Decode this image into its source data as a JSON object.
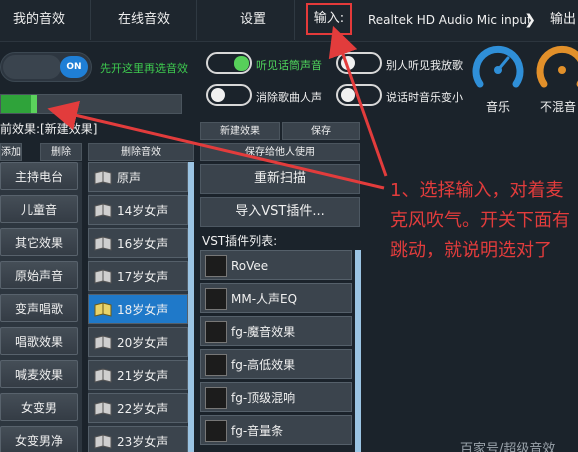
{
  "tabs": [
    "我的音效",
    "在线音效",
    "设置"
  ],
  "input_label": "输入:",
  "input_device": "Realtek HD Audio Mic input",
  "output_label": "输出",
  "main_toggle": {
    "state": "ON",
    "hint": "先开这里再选音效"
  },
  "toggles": [
    {
      "label": "听见话筒声音",
      "on": true
    },
    {
      "label": "别人听见我放歌",
      "on": false
    },
    {
      "label": "消除歌曲人声",
      "on": false
    },
    {
      "label": "说话时音乐变小",
      "on": false
    }
  ],
  "gauges": [
    {
      "label": "音乐",
      "color": "#2f8fd8"
    },
    {
      "label": "不混音",
      "color": "#e2902a"
    }
  ],
  "meter_level": 0.2,
  "current_effect": "前效果:[新建效果]",
  "buttons": {
    "add": "添加",
    "delete": "删除",
    "delete_effect": "删除音效",
    "new_effect": "新建效果",
    "save": "保存",
    "save_for_others": "保存给他人使用",
    "rescan": "重新扫描",
    "import_vst": "导入VST插件..."
  },
  "categories": [
    "主持电台",
    "儿童音",
    "其它效果",
    "原始声音",
    "变声唱歌",
    "唱歌效果",
    "喊麦效果",
    "女变男",
    "女变男净"
  ],
  "voices": [
    "原声",
    "14岁女声",
    "16岁女声",
    "17岁女声",
    "18岁女声",
    "20岁女声",
    "21岁女声",
    "22岁女声",
    "23岁女声"
  ],
  "selected_voice_index": 4,
  "vst_list_title": "VST插件列表:",
  "vst_plugins": [
    "RoVee",
    "MM-人声EQ",
    "fg-魔音效果",
    "fg-高低效果",
    "fg-顶级混响",
    "fg-音量条"
  ],
  "annotation": "1、选择输入，对着麦克风吹气。开关下面有跳动，就说明选对了",
  "watermark": "百家号/超级音效",
  "colors": {
    "accent": "#1f79c9",
    "annotation": "#e23c3c",
    "green": "#3ecb4f"
  }
}
